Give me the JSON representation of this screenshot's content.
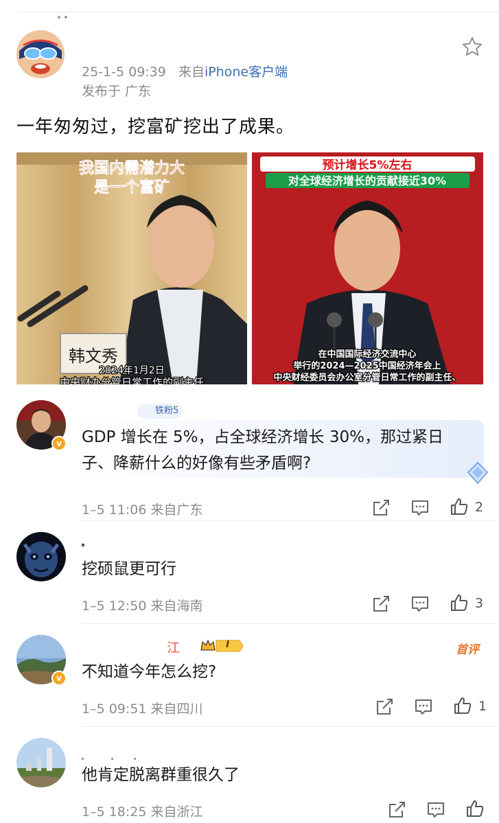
{
  "post": {
    "time": "25-1-5 09:39",
    "source_prefix": "来自",
    "source": "iPhone客户端",
    "location": "发布于 广东",
    "text": "一年匆匆过，挖富矿挖出了成果。",
    "images": [
      {
        "caption_top_1": "我国内需潜力大",
        "caption_top_2": "是一个富矿",
        "nameplate": "韩文秀",
        "caption_bottom_1": "2024年1月2日",
        "caption_bottom_2": "中央财办分管日常工作的副主任"
      },
      {
        "caption_top_1": "预计增长5%左右",
        "caption_top_2": "对全球经济增长的贡献接近30%",
        "caption_bottom_1": "在中国国际经济交流中心",
        "caption_bottom_2": "举行的2024—2025中国经济年会上",
        "caption_bottom_3": "中央财经委员会办公室分管日常工作的副主任、"
      }
    ]
  },
  "comments": [
    {
      "fan_badge": "铁粉5",
      "text_line1": "GDP 增长在 5%，占全球经济增长 30%，那过紧日",
      "text_line2": "子、降薪什么的好像有些矛盾啊?",
      "time": "1–5 11:06  来自广东",
      "likes": "2"
    },
    {
      "text_line1": "挖硕鼠更可行",
      "time": "1–5 12:50  来自海南",
      "likes": "3"
    },
    {
      "name_fragment": "江",
      "level_badge": "I",
      "top_badge": "首评",
      "text_line1": "不知道今年怎么挖?",
      "time": "1–5 09:51  来自四川",
      "likes": "1"
    },
    {
      "text_line1": "他肯定脱离群重很久了",
      "time": "1–5 18:25  来自浙江",
      "likes": ""
    }
  ],
  "icons": {
    "favorite": "star-icon",
    "share": "share-icon",
    "reply": "comment-icon",
    "like": "thumbs-up-icon"
  },
  "colors": {
    "link_blue": "#3d6fb3",
    "meta_gray": "#8a8a8a",
    "orange_badge": "#f5a623",
    "red_banner": "#b81d22"
  }
}
